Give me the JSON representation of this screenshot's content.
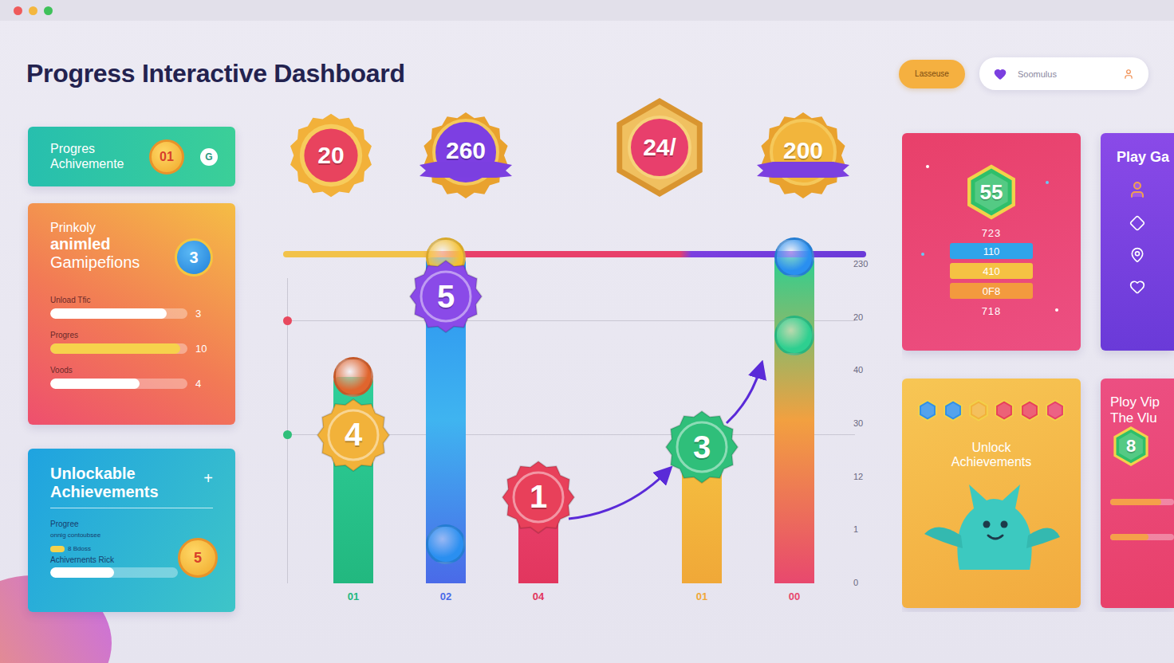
{
  "window": {
    "controls": [
      {
        "color": "#ef5b5b"
      },
      {
        "color": "#f4b73f"
      },
      {
        "color": "#3fc15a"
      }
    ]
  },
  "header": {
    "title": "Progress Interactive Dashboard",
    "button": "Lasseuse",
    "search": {
      "placeholder": "Soomulus"
    }
  },
  "achievements_card": {
    "title": [
      "Progres",
      "Achivemente"
    ],
    "badge": "01",
    "icon": "G"
  },
  "gamification_card": {
    "lines": [
      "Prinkoly",
      "animled",
      "Gamipefions"
    ],
    "badge": "3",
    "rows": [
      {
        "label": "Unload Tfic",
        "level": 0.85,
        "value": "3",
        "color": "#ffffff"
      },
      {
        "label": "Progres",
        "level": 0.95,
        "value": "10",
        "color": "#f6d24c"
      },
      {
        "label": "Voods",
        "level": 0.65,
        "value": "4",
        "color": "#ffffff"
      }
    ]
  },
  "unlockable_card": {
    "title": "Unlockable Achievements",
    "action": "+",
    "label": "Progree",
    "caption": "onnig contoubsee",
    "chip": "8 Bdoss",
    "bar_label": "Achivernents Rick",
    "level": 0.5,
    "badge": "5"
  },
  "medals": [
    {
      "value": "20",
      "kind": "round",
      "color": "#e8435e"
    },
    {
      "value": "260",
      "kind": "ribbon",
      "color": "#7d3fe2"
    },
    {
      "value": "24/",
      "kind": "hex",
      "color": "#e83f6c"
    },
    {
      "value": "200",
      "kind": "ribbon",
      "color": "#f2b53c"
    }
  ],
  "chart": {
    "max": 100,
    "ticks": [
      "230",
      "20",
      "40",
      "30",
      "12",
      "1",
      "0"
    ],
    "bars": [
      {
        "label": "01",
        "value": 62,
        "colors": [
          "#2fcf9a",
          "#22b87f"
        ],
        "knobs": [
          {
            "color": "#e0652e",
            "level": 1
          }
        ],
        "badges": [
          {
            "text": "4",
            "color": "#f2b23a",
            "level": 0.72
          }
        ]
      },
      {
        "label": "02",
        "value": 98,
        "colors": [
          "#2a8ff0",
          "#3fb4f0",
          "#4a6ae8"
        ],
        "knobs": [
          {
            "color": "#f5c030",
            "level": 1
          },
          {
            "color": "#2a8ff0",
            "level": 0.12
          }
        ],
        "badges": [
          {
            "text": "5",
            "color": "#8a4ae8",
            "level": 0.88
          }
        ]
      },
      {
        "label": "04",
        "value": 26,
        "colors": [
          "#e8406a",
          "#e2365e"
        ],
        "knobs": [],
        "badges": [
          {
            "text": "1",
            "color": "#e8405a",
            "level": 1
          }
        ]
      },
      {
        "label": "01",
        "value": 41,
        "colors": [
          "#f5c040",
          "#f0a838"
        ],
        "knobs": [],
        "badges": [
          {
            "text": "3",
            "color": "#2fbf7a",
            "level": 1
          }
        ]
      },
      {
        "label": "00",
        "value": 98,
        "colors": [
          "#2ecf90",
          "#f2a040",
          "#e8486e"
        ],
        "knobs": [
          {
            "color": "#2a8ff0",
            "level": 1
          },
          {
            "color": "#2ecf90",
            "level": 0.76
          }
        ],
        "badges": []
      }
    ]
  },
  "score_card": {
    "value": "55",
    "top": "723",
    "pills": [
      {
        "text": "110",
        "color": "#2fa4ea"
      },
      {
        "text": "410",
        "color": "#f5c243"
      },
      {
        "text": "0F8",
        "color": "#f39a3e"
      }
    ],
    "bottom": "718"
  },
  "play_card": {
    "title": "Play Ga"
  },
  "unlock_card": {
    "gems": [
      {
        "color": "#2f8fe8"
      },
      {
        "color": "#2f8fe8"
      },
      {
        "color": "#f2b23a"
      },
      {
        "color": "#e8405a"
      },
      {
        "color": "#e8405a"
      },
      {
        "color": "#e8406a"
      }
    ],
    "title": "Unlock Achievements"
  },
  "vip_card": {
    "lines": [
      "Ploy Vip",
      "The Vlu"
    ],
    "badge": "8",
    "levels": [
      0.8,
      0.6
    ]
  }
}
